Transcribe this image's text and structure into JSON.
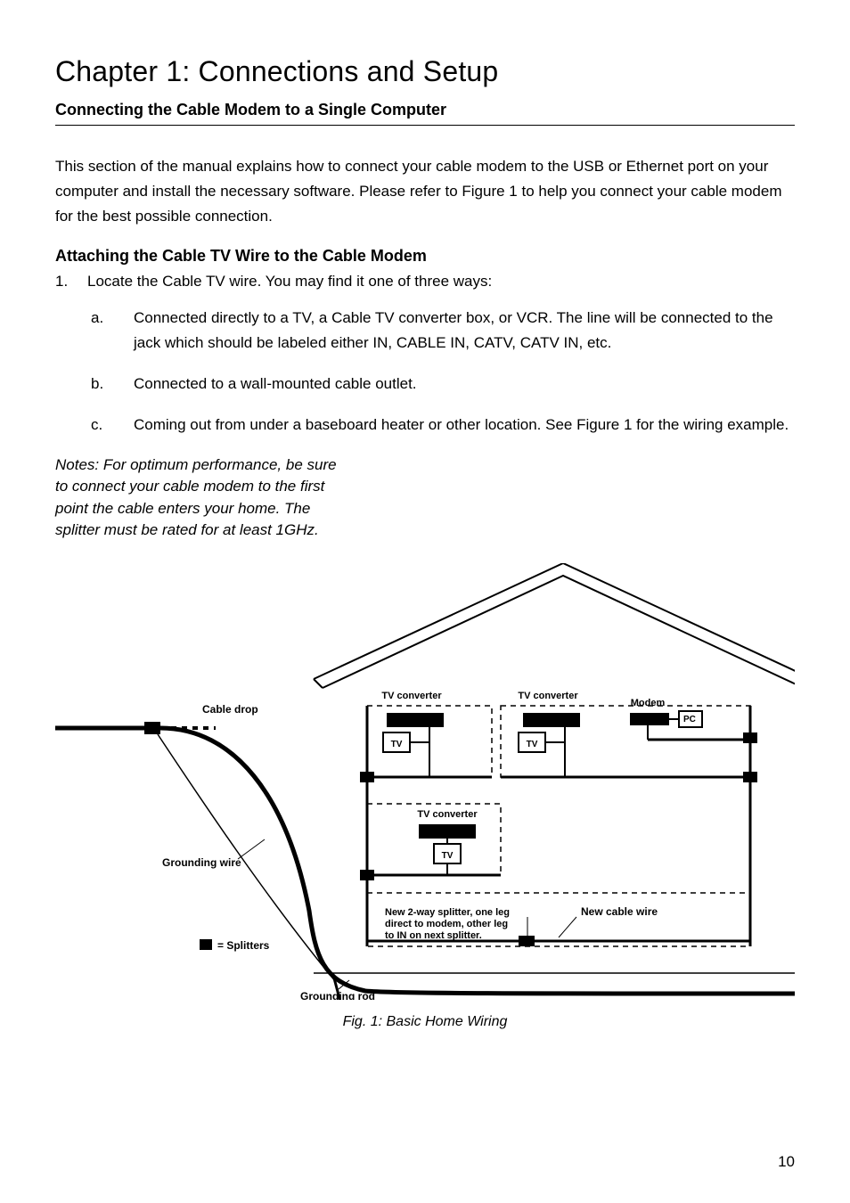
{
  "chapter_title": "Chapter 1: Connections and Setup",
  "section_title": "Connecting the Cable Modem to a Single Computer",
  "intro_paragraph": "This section of the manual explains how to connect your cable modem to the USB or Ethernet port on your computer and install the necessary software.   Please refer to Figure 1 to help you connect your cable modem for the best possible connection.",
  "subsection_title": "Attaching the Cable TV Wire to the Cable Modem",
  "step": {
    "number": "1.",
    "text": "Locate the Cable TV wire. You may find it one of three ways:"
  },
  "subitems": {
    "a": {
      "letter": "a.",
      "text": "Connected directly to a TV, a Cable TV converter box, or VCR. The line will be connected to the jack which should be labeled either IN, CABLE IN, CATV, CATV IN, etc."
    },
    "b": {
      "letter": "b.",
      "text": "Connected to a wall-mounted cable outlet."
    },
    "c": {
      "letter": "c.",
      "text": "Coming out from under a baseboard heater or other location. See Figure 1 for the wiring example."
    }
  },
  "notes_text": "Notes:   For optimum performance, be sure to connect your cable modem to the first point the cable enters your home. The splitter must be rated for at least 1GHz.",
  "figure": {
    "caption": "Fig. 1:   Basic Home Wiring",
    "labels": {
      "cable_drop": "Cable drop",
      "tv_converter": "TV converter",
      "modem": "Modem",
      "pc": "PC",
      "tv": "TV",
      "grounding_wire": "Grounding wire",
      "splitters_key": "= Splitters",
      "splitter_note_l1": "New 2-way splitter, one leg",
      "splitter_note_l2": "direct to modem, other leg",
      "splitter_note_l3": "to IN on next splitter.",
      "new_cable_wire": "New cable wire",
      "grounding_rod": "Grounding rod"
    }
  },
  "page_number": "10"
}
